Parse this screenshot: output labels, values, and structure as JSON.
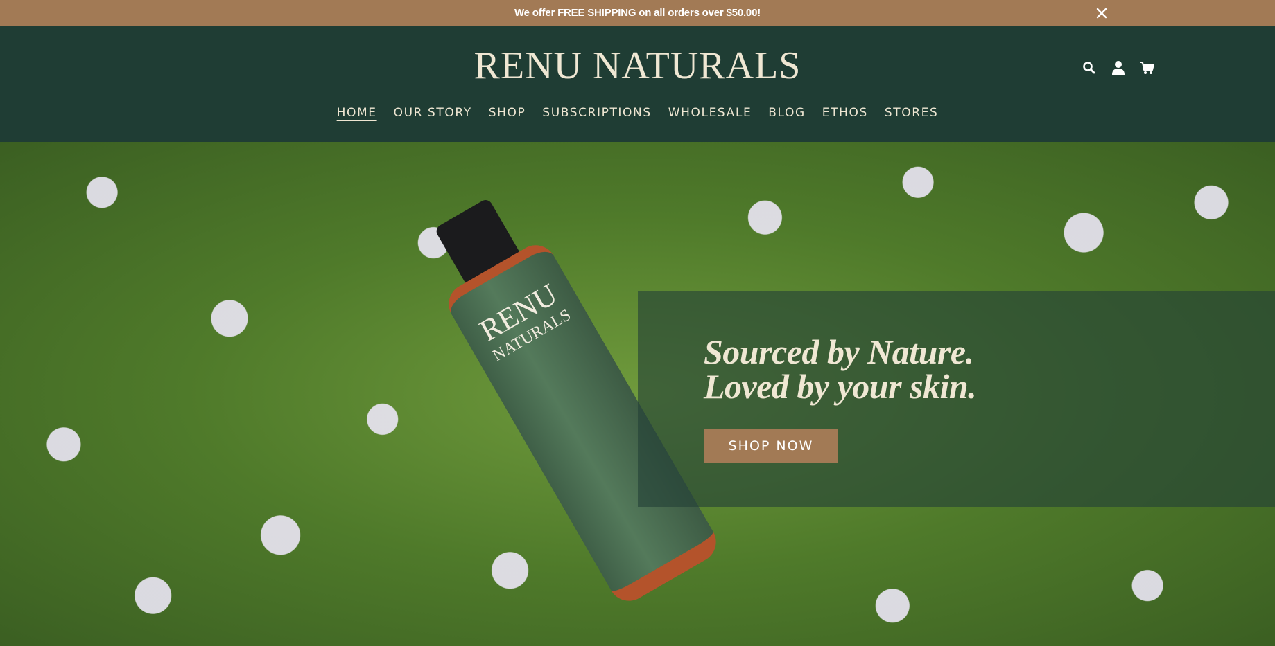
{
  "announcement": {
    "text": "We offer FREE SHIPPING on all orders over $50.00!",
    "close_icon": "close-icon"
  },
  "header": {
    "logo": "RENU NATURALS",
    "icons": [
      "search-icon",
      "account-icon",
      "cart-icon"
    ]
  },
  "nav": {
    "items": [
      {
        "label": "HOME",
        "active": true
      },
      {
        "label": "OUR STORY"
      },
      {
        "label": "SHOP"
      },
      {
        "label": "SUBSCRIPTIONS"
      },
      {
        "label": "WHOLESALE"
      },
      {
        "label": "BLOG"
      },
      {
        "label": "ETHOS"
      },
      {
        "label": "STORES"
      }
    ]
  },
  "hero": {
    "product_brand_line1": "RENU",
    "product_brand_line2": "NATURALS",
    "tagline_line1": "Sourced by Nature.",
    "tagline_line2": "Loved by your skin.",
    "cta_label": "SHOP NOW"
  },
  "colors": {
    "announcement_bg": "#a27a55",
    "header_bg": "#1f3d34",
    "text_cream": "#efe7d3",
    "cta_bg": "#a27a55"
  }
}
